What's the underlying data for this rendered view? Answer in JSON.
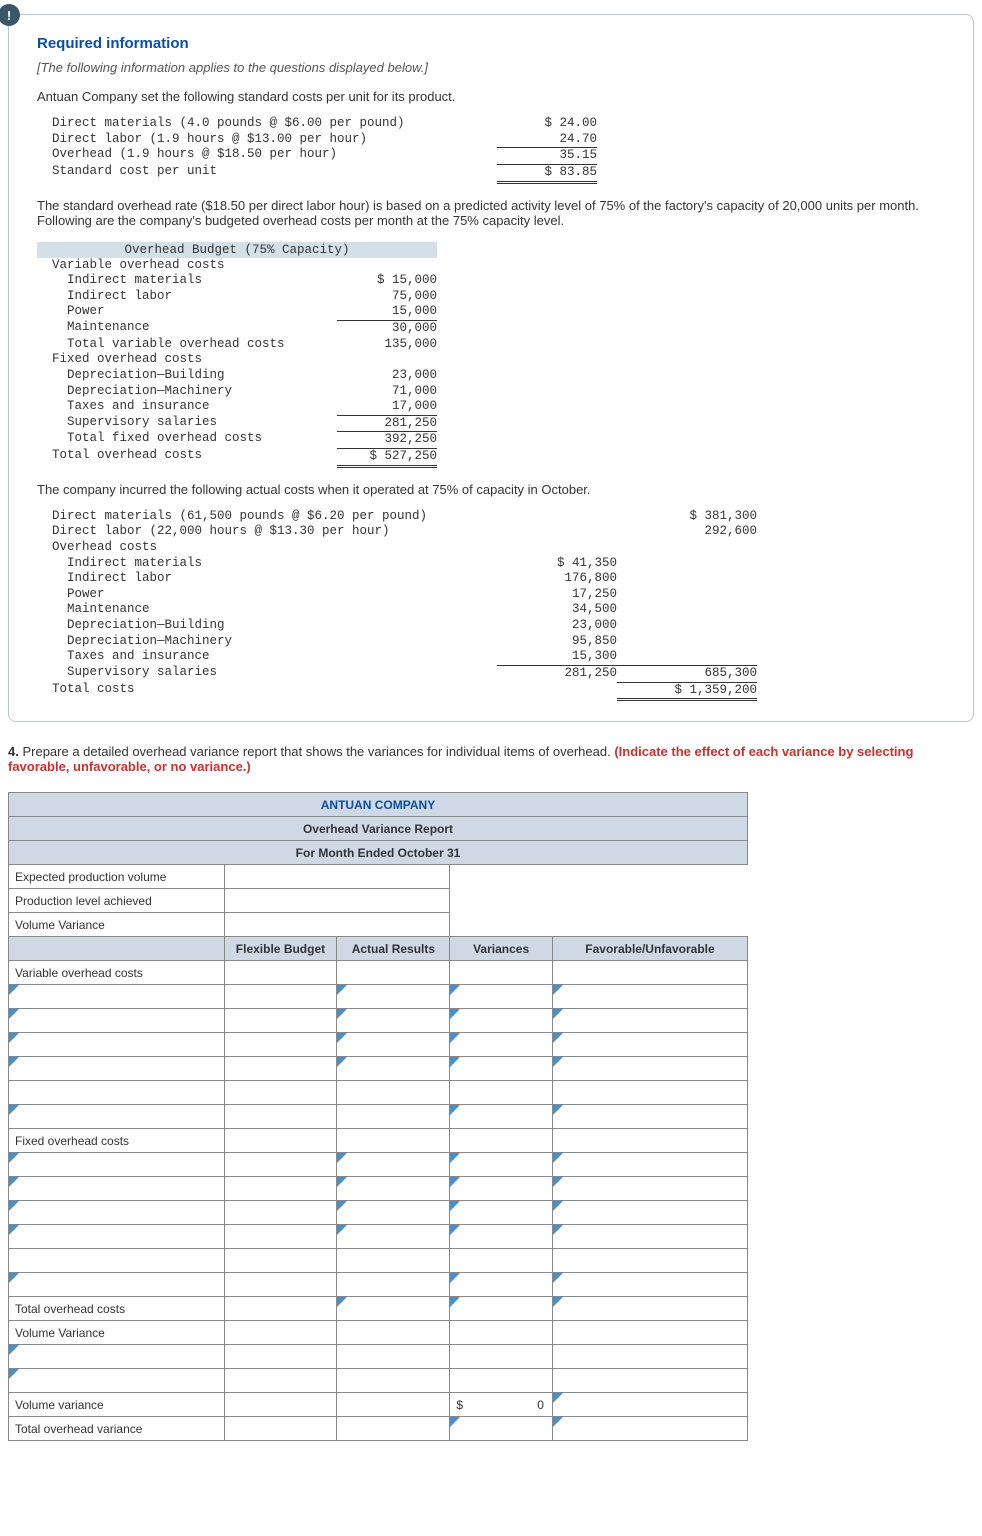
{
  "badge_icon": "!",
  "heading": "Required information",
  "subheading": "[The following information applies to the questions displayed below.]",
  "intro": "Antuan Company set the following standard costs per unit for its product.",
  "std_cost": {
    "r1": {
      "lbl": "  Direct materials (4.0 pounds @ $6.00 per pound)",
      "val": "$ 24.00"
    },
    "r2": {
      "lbl": "  Direct labor (1.9 hours @ $13.00 per hour)",
      "val": "24.70"
    },
    "r3": {
      "lbl": "  Overhead (1.9 hours @ $18.50 per hour)",
      "val": "35.15"
    },
    "r4": {
      "lbl": "  Standard cost per unit",
      "val": "$ 83.85"
    }
  },
  "p1": "The standard overhead rate ($18.50 per direct labor hour) is based on a predicted activity level of 75% of the factory's capacity of 20,000 units per month. Following are the company's budgeted overhead costs per month at the 75% capacity level.",
  "budget_title": "Overhead Budget (75% Capacity)",
  "budget": {
    "voc_h": "  Variable overhead costs",
    "im": {
      "lbl": "    Indirect materials",
      "val": "$ 15,000"
    },
    "il": {
      "lbl": "    Indirect labor",
      "val": "75,000"
    },
    "pw": {
      "lbl": "    Power",
      "val": "15,000"
    },
    "mt": {
      "lbl": "    Maintenance",
      "val": "30,000"
    },
    "tv": {
      "lbl": "    Total variable overhead costs",
      "val": "135,000"
    },
    "foc_h": "  Fixed overhead costs",
    "db": {
      "lbl": "    Depreciation—Building",
      "val": "23,000"
    },
    "dm": {
      "lbl": "    Depreciation—Machinery",
      "val": "71,000"
    },
    "ti": {
      "lbl": "    Taxes and insurance",
      "val": "17,000"
    },
    "ss": {
      "lbl": "    Supervisory salaries",
      "val": "281,250"
    },
    "tf": {
      "lbl": "    Total fixed overhead costs",
      "val": "392,250"
    },
    "to": {
      "lbl": "  Total overhead costs",
      "val": "$ 527,250"
    }
  },
  "p2": "The company incurred the following actual costs when it operated at 75% of capacity in October.",
  "actual": {
    "dm": {
      "lbl": "  Direct materials (61,500 pounds @ $6.20 per pound)",
      "v2": "",
      "v3": "$ 381,300"
    },
    "dl": {
      "lbl": "  Direct labor (22,000 hours @ $13.30 per hour)",
      "v2": "",
      "v3": "292,600"
    },
    "oc_h": "  Overhead costs",
    "im": {
      "lbl": "    Indirect materials",
      "v2": "$ 41,350",
      "v3": ""
    },
    "il": {
      "lbl": "    Indirect labor",
      "v2": "176,800",
      "v3": ""
    },
    "pw": {
      "lbl": "    Power",
      "v2": "17,250",
      "v3": ""
    },
    "mt": {
      "lbl": "    Maintenance",
      "v2": "34,500",
      "v3": ""
    },
    "db": {
      "lbl": "    Depreciation—Building",
      "v2": "23,000",
      "v3": ""
    },
    "dmc": {
      "lbl": "    Depreciation—Machinery",
      "v2": "95,850",
      "v3": ""
    },
    "ti": {
      "lbl": "    Taxes and insurance",
      "v2": "15,300",
      "v3": ""
    },
    "ss": {
      "lbl": "    Supervisory salaries",
      "v2": "281,250",
      "v3": "685,300"
    },
    "tc": {
      "lbl": "  Total costs",
      "v2": "",
      "v3": "$ 1,359,200"
    }
  },
  "question": {
    "num": "4.",
    "text": "Prepare a detailed overhead variance report that shows the variances for individual items of overhead. ",
    "red": "(Indicate the effect of each variance by selecting favorable, unfavorable, or no variance.)"
  },
  "report": {
    "company": "ANTUAN COMPANY",
    "title": "Overhead Variance Report",
    "period": "For Month Ended October 31",
    "row1": "Expected production volume",
    "row2": "Production level achieved",
    "row3": "Volume Variance",
    "h1": "Flexible Budget",
    "h2": "Actual Results",
    "h3": "Variances",
    "h4": "Favorable/Unfavorable",
    "voc": "Variable overhead costs",
    "foc": "Fixed overhead costs",
    "toc": "Total overhead costs",
    "vv": "Volume Variance",
    "vv2": "Volume variance",
    "tov": "Total overhead variance",
    "zero_sym": "$",
    "zero_val": "0"
  }
}
